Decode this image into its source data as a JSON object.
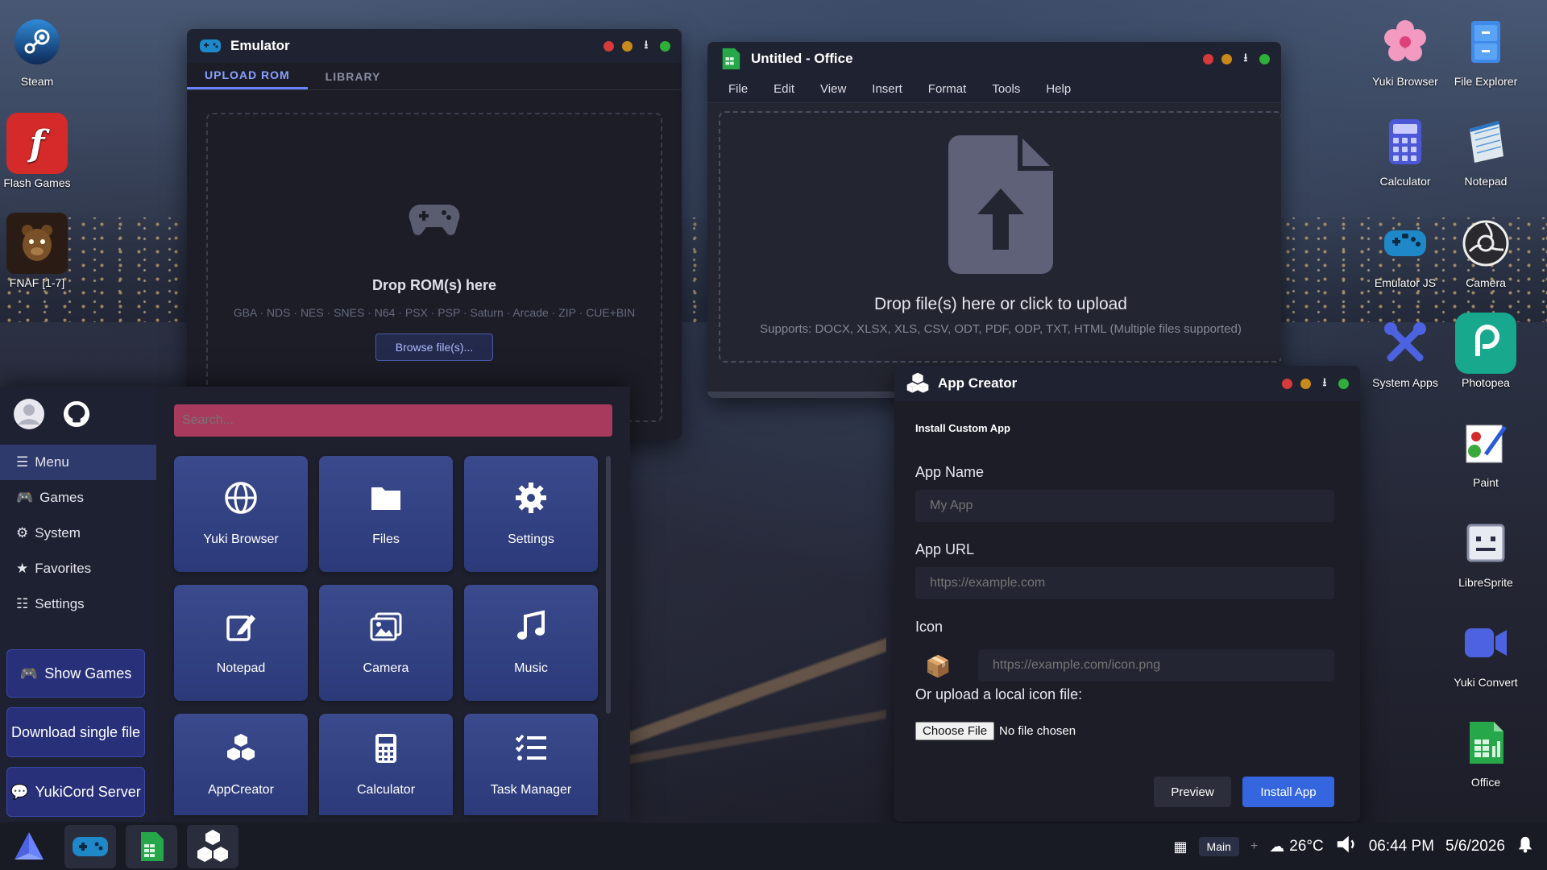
{
  "desktop": {
    "left_icons": [
      {
        "label": "Steam",
        "icon": "steam-icon"
      },
      {
        "label": "Flash Games",
        "icon": "flash-icon"
      },
      {
        "label": "FNAF [1-7]",
        "icon": "fnaf-icon"
      }
    ],
    "right_icons": [
      {
        "label": "Yuki Browser",
        "icon": "flower-icon"
      },
      {
        "label": "File Explorer",
        "icon": "file-cabinet-icon"
      },
      {
        "label": "Calculator",
        "icon": "calculator-icon"
      },
      {
        "label": "Notepad",
        "icon": "notepad-icon"
      },
      {
        "label": "Emulator JS",
        "icon": "gamepad-icon"
      },
      {
        "label": "Camera",
        "icon": "camera-icon"
      },
      {
        "label": "System Apps",
        "icon": "tools-icon"
      },
      {
        "label": "Photopea",
        "icon": "photopea-icon"
      },
      {
        "label": "Paint",
        "icon": "paint-icon"
      },
      {
        "label": "LibreSprite",
        "icon": "sprite-icon"
      },
      {
        "label": "Yuki Convert",
        "icon": "video-icon"
      },
      {
        "label": "Office",
        "icon": "spreadsheet-icon"
      }
    ]
  },
  "emulator": {
    "title": "Emulator",
    "tabs": [
      "UPLOAD ROM",
      "LIBRARY"
    ],
    "drop_title": "Drop ROM(s) here",
    "formats": "GBA · NDS · NES · SNES · N64 · PSX · PSP · Saturn · Arcade · ZIP · CUE+BIN",
    "browse_label": "Browse file(s)..."
  },
  "office": {
    "title": "Untitled - Office",
    "menu": [
      "File",
      "Edit",
      "View",
      "Insert",
      "Format",
      "Tools",
      "Help"
    ],
    "drop_title": "Drop file(s) here or click to upload",
    "supports": "Supports: DOCX, XLSX, XLS, CSV, ODT, PDF, ODP, TXT, HTML (Multiple files supported)"
  },
  "app_creator": {
    "title": "App Creator",
    "heading": "Install Custom App",
    "name_label": "App Name",
    "name_placeholder": "My App",
    "url_label": "App URL",
    "url_placeholder": "https://example.com",
    "icon_label": "Icon",
    "icon_placeholder": "https://example.com/icon.png",
    "upload_label": "Or upload a local icon file:",
    "choose_file": "Choose File",
    "no_file": "No file chosen",
    "preview_label": "Preview",
    "install_label": "Install App"
  },
  "start_menu": {
    "search_placeholder": "Search...",
    "nav": [
      "Menu",
      "Games",
      "System",
      "Favorites",
      "Settings"
    ],
    "buttons": [
      "Show Games",
      "Download single file",
      "YukiCord Server"
    ],
    "tiles": [
      "Yuki Browser",
      "Files",
      "Settings",
      "Notepad",
      "Camera",
      "Music",
      "AppCreator",
      "Calculator",
      "Task Manager"
    ]
  },
  "taskbar": {
    "workspace": "Main",
    "plus": "+",
    "weather": "26°C",
    "time": "06:44 PM",
    "date": "5/6/2026"
  },
  "colors": {
    "accent": "#6a82ff",
    "install_button": "#3566e0",
    "search_bar": "#a83a5e",
    "tile": "#33438a"
  }
}
